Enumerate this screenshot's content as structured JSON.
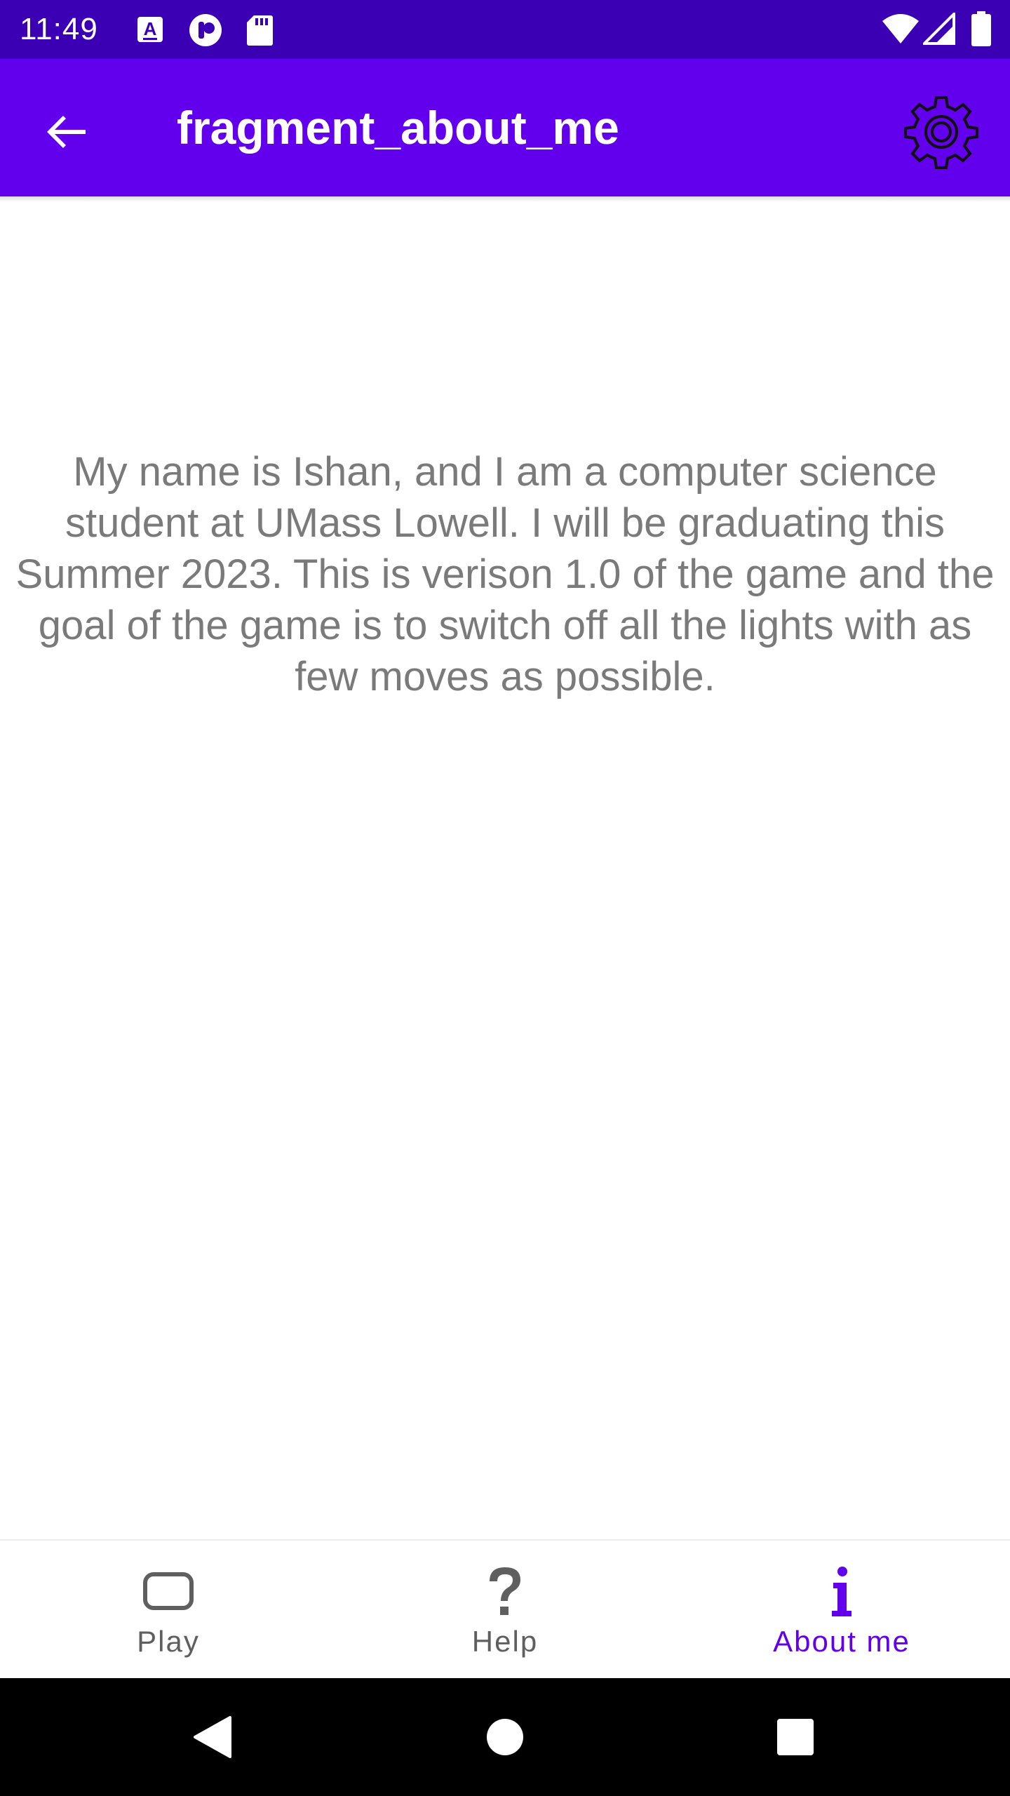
{
  "status_bar": {
    "time": "11:49",
    "icons": [
      "autofill-icon",
      "media-icon",
      "sd-card-icon",
      "wifi-icon",
      "signal-icon",
      "battery-icon"
    ]
  },
  "app_bar": {
    "title": "fragment_about_me",
    "back_icon": "arrow-back-icon",
    "settings_icon": "gear-icon"
  },
  "content": {
    "about_text": "My name is Ishan, and I am a computer science student at UMass Lowell. I will be graduating this Summer 2023. This is verison 1.0 of the game and the goal of the game is to switch off all the lights with as few moves as possible."
  },
  "bottom_nav": {
    "items": [
      {
        "label": "Play",
        "icon": "rounded-square-icon",
        "active": false
      },
      {
        "label": "Help",
        "icon": "question-mark-icon",
        "active": false
      },
      {
        "label": "About me",
        "icon": "info-icon",
        "active": true
      }
    ]
  },
  "colors": {
    "status_bar": "#3b00b3",
    "app_bar": "#6200ee",
    "accent": "#6200ee",
    "body_text": "#7a7a7a",
    "nav_inactive": "#5f5f5f"
  }
}
